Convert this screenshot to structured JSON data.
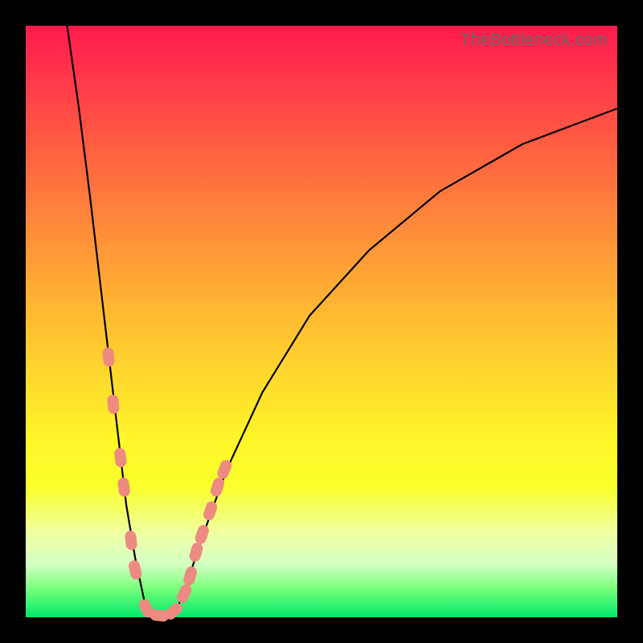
{
  "watermark_text": "TheBottleneck.com",
  "colors": {
    "frame": "#000000",
    "marker": "#ed8a81",
    "curve": "#000000",
    "gradient_top": "#ff1a4d",
    "gradient_bottom": "#00e86a"
  },
  "chart_data": {
    "type": "line",
    "title": "",
    "xlabel": "",
    "ylabel": "",
    "x_range_pct": [
      0,
      100
    ],
    "y_range_pct": [
      0,
      100
    ],
    "notes": "V-shaped bottleneck curve over vertical rainbow gradient (red=high bottleneck, green=0%). No axis ticks or numeric labels shown. Values are approximate percentages of plot width (x) and bottleneck % (y) read from pixel positions.",
    "series": [
      {
        "name": "left-branch",
        "x": [
          7,
          9,
          11,
          13,
          15,
          17,
          18.5,
          20,
          21
        ],
        "y": [
          100,
          86,
          70,
          53,
          36,
          19,
          10,
          3,
          0
        ]
      },
      {
        "name": "floor",
        "x": [
          21,
          25
        ],
        "y": [
          0,
          0
        ]
      },
      {
        "name": "right-branch",
        "x": [
          25,
          27,
          30,
          34,
          40,
          48,
          58,
          70,
          84,
          100
        ],
        "y": [
          0,
          5,
          14,
          25,
          38,
          51,
          62,
          72,
          80,
          86
        ]
      }
    ],
    "markers": {
      "name": "highlighted-points",
      "shape": "pill",
      "points_xy_pct": [
        [
          14.0,
          44
        ],
        [
          14.8,
          36
        ],
        [
          16.0,
          27
        ],
        [
          16.6,
          22
        ],
        [
          17.8,
          13
        ],
        [
          18.5,
          8
        ],
        [
          20.4,
          1.5
        ],
        [
          22.6,
          0.3
        ],
        [
          25.0,
          1.0
        ],
        [
          26.8,
          4
        ],
        [
          27.8,
          7
        ],
        [
          28.8,
          11
        ],
        [
          29.8,
          14
        ],
        [
          31.2,
          18
        ],
        [
          32.4,
          22
        ],
        [
          33.6,
          25
        ]
      ]
    }
  }
}
